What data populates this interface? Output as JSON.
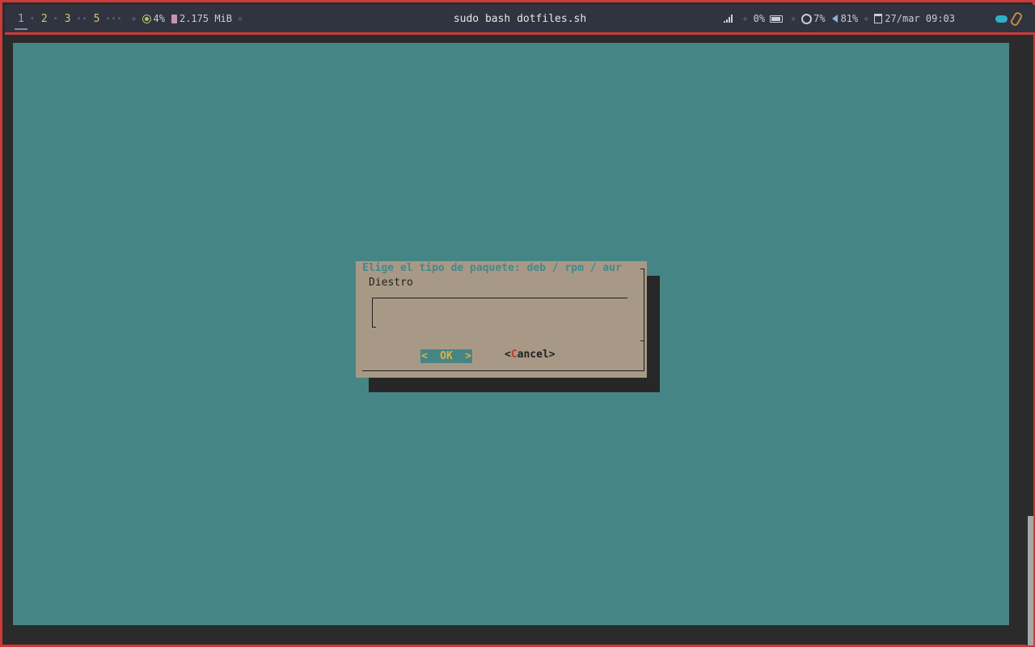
{
  "window_title": "sudo bash dotfiles.sh",
  "workspaces": [
    "1",
    "2",
    "3",
    "5"
  ],
  "status": {
    "cpu": "4%",
    "memory": "2.175 MiB",
    "wifi": "0%",
    "brightness": "7%",
    "volume": "81%",
    "datetime": "27/mar 09:03"
  },
  "dialog": {
    "title": "Elige el tipo de paquete: deb / rpm / aur",
    "message": "Diestro",
    "input_value": "",
    "ok_label": "OK",
    "cancel_hotkey": "C",
    "cancel_rest": "ancel"
  },
  "colors": {
    "terminal_bg": "#468586",
    "dialog_bg": "#a89986",
    "accent_border": "#cc3a3a",
    "title_color": "#3f8a8f",
    "ok_bg": "#468586",
    "ok_text": "#d9b24a"
  },
  "icons": [
    "cpu-icon",
    "memory-icon",
    "wifi-icon",
    "battery-icon",
    "brightness-icon",
    "volume-icon",
    "calendar-icon",
    "cloud-icon",
    "paperclip-icon"
  ]
}
